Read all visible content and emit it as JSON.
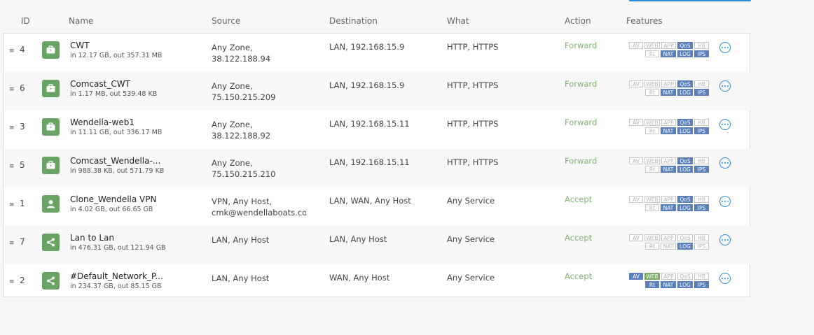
{
  "header": {
    "id": "ID",
    "name": "Name",
    "source": "Source",
    "destination": "Destination",
    "what": "What",
    "action": "Action",
    "features": "Features"
  },
  "feature_labels": [
    "AV",
    "WEB",
    "APP",
    "QoS",
    "HB",
    "Rt",
    "NAT",
    "LOG",
    "IPS"
  ],
  "rows": [
    {
      "id": "4",
      "icon": "briefcase-icon",
      "name": "CWT",
      "traffic": "in 12.17 GB, out 357.31 MB",
      "source_line1": "Any Zone,",
      "source_line2": "38.122.188.94",
      "destination": "LAN, 192.168.15.9",
      "what": "HTTP, HTTPS",
      "action": "Forward",
      "active": [
        "QoS",
        "NAT",
        "LOG",
        "IPS"
      ]
    },
    {
      "id": "6",
      "icon": "briefcase-icon",
      "name": "Comcast_CWT",
      "traffic": "in 1.17 MB, out 539.48 KB",
      "source_line1": "Any Zone,",
      "source_line2": "75.150.215.209",
      "destination": "LAN, 192.168.15.9",
      "what": "HTTP, HTTPS",
      "action": "Forward",
      "active": [
        "QoS",
        "NAT",
        "LOG",
        "IPS"
      ]
    },
    {
      "id": "3",
      "icon": "briefcase-icon",
      "name": "Wendella-web1",
      "traffic": "in 11.11 GB, out 336.17 MB",
      "source_line1": "Any Zone,",
      "source_line2": "38.122.188.92",
      "destination": "LAN, 192.168.15.11",
      "what": "HTTP, HTTPS",
      "action": "Forward",
      "active": [
        "QoS",
        "NAT",
        "LOG",
        "IPS"
      ]
    },
    {
      "id": "5",
      "icon": "briefcase-icon",
      "name": "Comcast_Wendella-...",
      "traffic": "in 988.38 KB, out 571.79 KB",
      "source_line1": "Any Zone,",
      "source_line2": "75.150.215.210",
      "destination": "LAN, 192.168.15.11",
      "what": "HTTP, HTTPS",
      "action": "Forward",
      "active": [
        "QoS",
        "NAT",
        "LOG",
        "IPS"
      ]
    },
    {
      "id": "1",
      "icon": "user-icon",
      "name": "Clone_Wendella VPN",
      "traffic": "in 4.02 GB, out 66.65 GB",
      "source_line1": "VPN, Any Host,",
      "source_line2": "cmk@wendellaboats.com",
      "destination": "LAN, WAN, Any Host",
      "what": "Any Service",
      "action": "Accept",
      "active": [
        "QoS",
        "NAT",
        "LOG",
        "IPS"
      ]
    },
    {
      "id": "7",
      "icon": "share-icon",
      "name": "Lan to Lan",
      "traffic": "in 476.31 GB, out 121.94 GB",
      "source_line1": "LAN, Any Host",
      "source_line2": "",
      "destination": "LAN, Any Host",
      "what": "Any Service",
      "action": "Accept",
      "active": [
        "LOG"
      ]
    },
    {
      "id": "2",
      "icon": "share-icon",
      "name": "#Default_Network_P...",
      "traffic": "in 234.37 GB, out 85.15 GB",
      "source_line1": "LAN, Any Host",
      "source_line2": "",
      "destination": "WAN, Any Host",
      "what": "Any Service",
      "action": "Accept",
      "active": [
        "AV",
        "Rt",
        "NAT",
        "LOG",
        "IPS"
      ],
      "green": [
        "WEB"
      ]
    }
  ]
}
